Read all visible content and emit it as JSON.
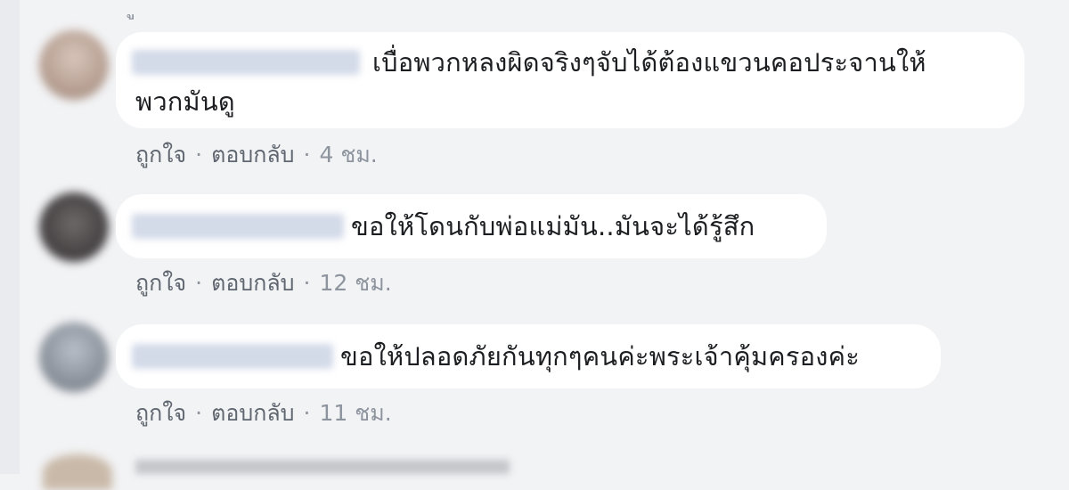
{
  "comments": [
    {
      "text_line1": "เบื่อพวกหลงผิดจริงๆจับได้ต้องแขวนคอประจานให้",
      "text_line2": "พวกมันดู",
      "like": "ถูกใจ",
      "reply": "ตอบกลับ",
      "time": "4 ชม."
    },
    {
      "text_line1": "ขอให้โดนกับพ่อแม่มัน..มันจะได้รู้สึก",
      "like": "ถูกใจ",
      "reply": "ตอบกลับ",
      "time": "12 ชม."
    },
    {
      "text_line1": "ขอให้ปลอดภัยกันทุกๆคนค่ะพระเจ้าคุ้มครองค่ะ",
      "like": "ถูกใจ",
      "reply": "ตอบกลับ",
      "time": "11 ชม."
    }
  ],
  "separator": "·",
  "colors": {
    "background": "#f2f3f5",
    "bubble": "#ffffff",
    "action_text": "#606770",
    "time_text": "#8d949e"
  }
}
